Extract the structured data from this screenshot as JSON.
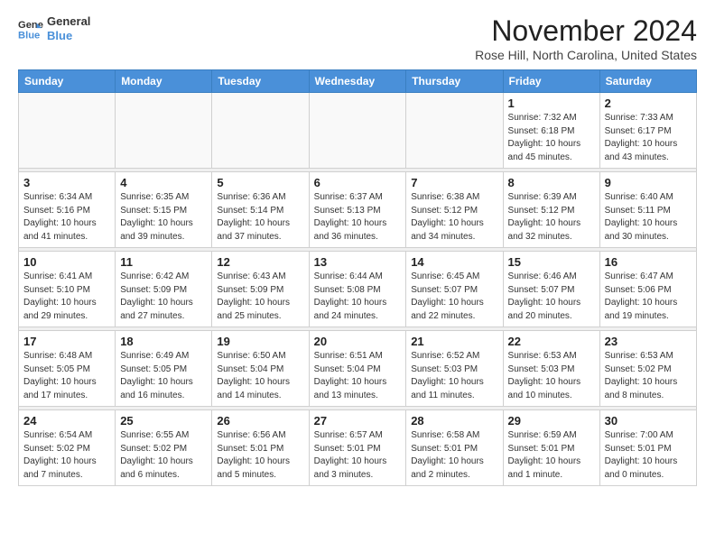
{
  "header": {
    "logo_line1": "General",
    "logo_line2": "Blue",
    "month": "November 2024",
    "location": "Rose Hill, North Carolina, United States"
  },
  "weekdays": [
    "Sunday",
    "Monday",
    "Tuesday",
    "Wednesday",
    "Thursday",
    "Friday",
    "Saturday"
  ],
  "weeks": [
    [
      {
        "day": "",
        "info": ""
      },
      {
        "day": "",
        "info": ""
      },
      {
        "day": "",
        "info": ""
      },
      {
        "day": "",
        "info": ""
      },
      {
        "day": "",
        "info": ""
      },
      {
        "day": "1",
        "info": "Sunrise: 7:32 AM\nSunset: 6:18 PM\nDaylight: 10 hours and 45 minutes."
      },
      {
        "day": "2",
        "info": "Sunrise: 7:33 AM\nSunset: 6:17 PM\nDaylight: 10 hours and 43 minutes."
      }
    ],
    [
      {
        "day": "3",
        "info": "Sunrise: 6:34 AM\nSunset: 5:16 PM\nDaylight: 10 hours and 41 minutes."
      },
      {
        "day": "4",
        "info": "Sunrise: 6:35 AM\nSunset: 5:15 PM\nDaylight: 10 hours and 39 minutes."
      },
      {
        "day": "5",
        "info": "Sunrise: 6:36 AM\nSunset: 5:14 PM\nDaylight: 10 hours and 37 minutes."
      },
      {
        "day": "6",
        "info": "Sunrise: 6:37 AM\nSunset: 5:13 PM\nDaylight: 10 hours and 36 minutes."
      },
      {
        "day": "7",
        "info": "Sunrise: 6:38 AM\nSunset: 5:12 PM\nDaylight: 10 hours and 34 minutes."
      },
      {
        "day": "8",
        "info": "Sunrise: 6:39 AM\nSunset: 5:12 PM\nDaylight: 10 hours and 32 minutes."
      },
      {
        "day": "9",
        "info": "Sunrise: 6:40 AM\nSunset: 5:11 PM\nDaylight: 10 hours and 30 minutes."
      }
    ],
    [
      {
        "day": "10",
        "info": "Sunrise: 6:41 AM\nSunset: 5:10 PM\nDaylight: 10 hours and 29 minutes."
      },
      {
        "day": "11",
        "info": "Sunrise: 6:42 AM\nSunset: 5:09 PM\nDaylight: 10 hours and 27 minutes."
      },
      {
        "day": "12",
        "info": "Sunrise: 6:43 AM\nSunset: 5:09 PM\nDaylight: 10 hours and 25 minutes."
      },
      {
        "day": "13",
        "info": "Sunrise: 6:44 AM\nSunset: 5:08 PM\nDaylight: 10 hours and 24 minutes."
      },
      {
        "day": "14",
        "info": "Sunrise: 6:45 AM\nSunset: 5:07 PM\nDaylight: 10 hours and 22 minutes."
      },
      {
        "day": "15",
        "info": "Sunrise: 6:46 AM\nSunset: 5:07 PM\nDaylight: 10 hours and 20 minutes."
      },
      {
        "day": "16",
        "info": "Sunrise: 6:47 AM\nSunset: 5:06 PM\nDaylight: 10 hours and 19 minutes."
      }
    ],
    [
      {
        "day": "17",
        "info": "Sunrise: 6:48 AM\nSunset: 5:05 PM\nDaylight: 10 hours and 17 minutes."
      },
      {
        "day": "18",
        "info": "Sunrise: 6:49 AM\nSunset: 5:05 PM\nDaylight: 10 hours and 16 minutes."
      },
      {
        "day": "19",
        "info": "Sunrise: 6:50 AM\nSunset: 5:04 PM\nDaylight: 10 hours and 14 minutes."
      },
      {
        "day": "20",
        "info": "Sunrise: 6:51 AM\nSunset: 5:04 PM\nDaylight: 10 hours and 13 minutes."
      },
      {
        "day": "21",
        "info": "Sunrise: 6:52 AM\nSunset: 5:03 PM\nDaylight: 10 hours and 11 minutes."
      },
      {
        "day": "22",
        "info": "Sunrise: 6:53 AM\nSunset: 5:03 PM\nDaylight: 10 hours and 10 minutes."
      },
      {
        "day": "23",
        "info": "Sunrise: 6:53 AM\nSunset: 5:02 PM\nDaylight: 10 hours and 8 minutes."
      }
    ],
    [
      {
        "day": "24",
        "info": "Sunrise: 6:54 AM\nSunset: 5:02 PM\nDaylight: 10 hours and 7 minutes."
      },
      {
        "day": "25",
        "info": "Sunrise: 6:55 AM\nSunset: 5:02 PM\nDaylight: 10 hours and 6 minutes."
      },
      {
        "day": "26",
        "info": "Sunrise: 6:56 AM\nSunset: 5:01 PM\nDaylight: 10 hours and 5 minutes."
      },
      {
        "day": "27",
        "info": "Sunrise: 6:57 AM\nSunset: 5:01 PM\nDaylight: 10 hours and 3 minutes."
      },
      {
        "day": "28",
        "info": "Sunrise: 6:58 AM\nSunset: 5:01 PM\nDaylight: 10 hours and 2 minutes."
      },
      {
        "day": "29",
        "info": "Sunrise: 6:59 AM\nSunset: 5:01 PM\nDaylight: 10 hours and 1 minute."
      },
      {
        "day": "30",
        "info": "Sunrise: 7:00 AM\nSunset: 5:01 PM\nDaylight: 10 hours and 0 minutes."
      }
    ]
  ]
}
